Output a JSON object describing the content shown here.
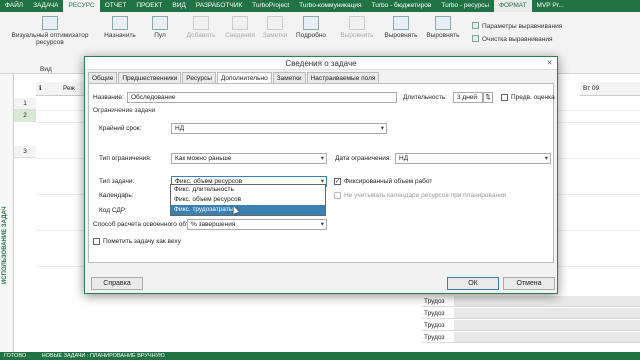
{
  "ribbon": {
    "tabs": [
      "ФАЙЛ",
      "ЗАДАЧА",
      "РЕСУРС",
      "ОТЧЕТ",
      "ПРОЕКТ",
      "ВИД",
      "РАЗРАБОТЧИК",
      "TurboProject",
      "Turbo-коммуникация",
      "Turbo - бюджетиров",
      "Turbo - ресурсы",
      "ФОРМАТ",
      "MVP Pr..."
    ],
    "active_tab": "РЕСУРС",
    "buttons": {
      "visual_optimizer": "Визуальный оптимизатор ресурсов",
      "assign": "Назначить",
      "pool": "Пул",
      "add": "Добавить",
      "info": "Сведения",
      "notes": "Заметки",
      "details": "Подробно",
      "level_sel": "Выровнять",
      "level": "Выровнять",
      "level2": "Выровнять"
    },
    "side_items": [
      "Параметры выравнивания",
      "Очистка выравнивания"
    ],
    "group_view": "Вид",
    "clear": "Очистка выравнивания"
  },
  "sheet": {
    "side_label": "ИСПОЛЬЗОВАНИЕ ЗАДАЧ",
    "col_mode": "Реж",
    "col_date": "Вт 09",
    "rows": [
      "1",
      "2",
      "3"
    ],
    "trud_label": "Трудоз"
  },
  "dialog": {
    "title": "Сведения о задаче",
    "close": "✕",
    "tabs": [
      "Общие",
      "Предшественники",
      "Ресурсы",
      "Дополнительно",
      "Заметки",
      "Настраиваемые поля"
    ],
    "active_tab": "Дополнительно",
    "name_label": "Название:",
    "name_value": "Обследование",
    "duration_label": "Длительность:",
    "duration_value": "3 дней",
    "estimate_label": "Предв. оценка",
    "constraint_section": "Ограничение задачи",
    "deadline_label": "Крайний срок:",
    "deadline_value": "НД",
    "constraint_type_label": "Тип ограничения:",
    "constraint_type_value": "Как можно раньше",
    "constraint_date_label": "Дата ограничения:",
    "constraint_date_value": "НД",
    "task_type_label": "Тип задачи:",
    "task_type_value": "Фикс. объем ресурсов",
    "effort_driven_label": "Фиксированный объем работ",
    "calendar_label": "Календарь:",
    "ignore_calendars_label": "Не учитывать календари ресурсов при планировании",
    "wbs_label": "Код СДР:",
    "earned_value_label": "Способ расчета освоенного объема:",
    "earned_value_value": "% завершения",
    "milestone_label": "Пометить задачу как веху",
    "task_type_options": [
      "Фикс. длительность",
      "Фикс. объем ресурсов",
      "Фикс. трудозатраты"
    ],
    "selected_option": "Фикс. трудозатраты",
    "help_button": "Справка",
    "ok_button": "ОК",
    "cancel_button": "Отмена"
  },
  "status": {
    "ready": "ГОТОВО",
    "new_tasks": "НОВЫЕ ЗАДАЧИ : ПЛАНИРОВАНИЕ ВРУЧНУЮ"
  }
}
